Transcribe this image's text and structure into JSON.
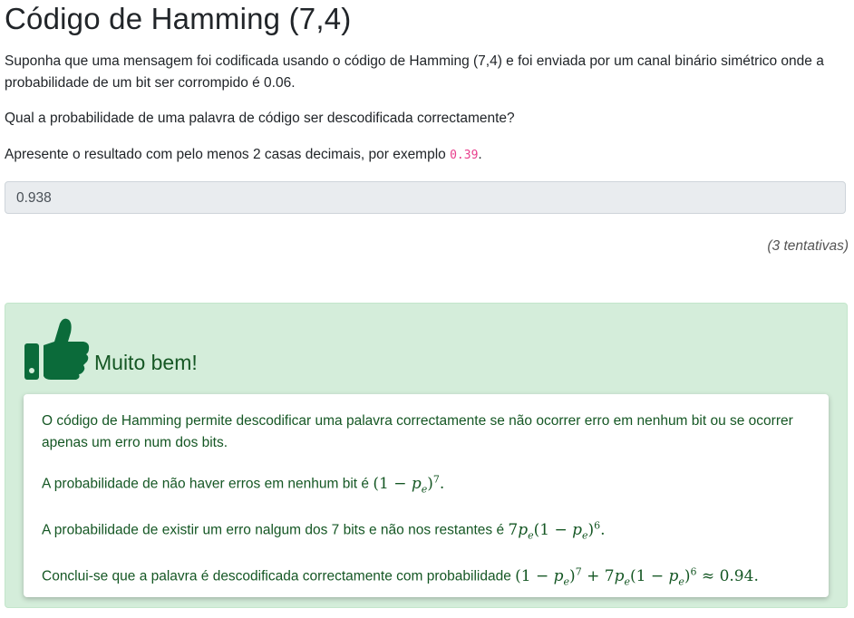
{
  "page": {
    "title": "Código de Hamming (7,4)",
    "paragraph1": "Suponha que uma mensagem foi codificada usando o código de Hamming (7,4) e foi enviada por um canal binário simétrico onde a probabilidade de um bit ser corrompido é 0.06.",
    "question": "Qual a probabilidade de uma palavra de código ser descodificada correctamente?",
    "instruction_prefix": "Apresente o resultado com pelo menos 2 casas decimais, por exemplo ",
    "instruction_example": "0.39",
    "instruction_suffix": "."
  },
  "answer": {
    "value": "0.938"
  },
  "attempts": "(3 tentativas)",
  "feedback": {
    "icon": "thumbs-up-icon",
    "heading": "Muito bem!",
    "explanation1": "O código de Hamming permite descodificar uma palavra correctamente se não ocorrer erro em nenhum bit ou se ocorrer apenas um erro num dos bits.",
    "explanation2_text": "A probabilidade de não haver erros em nenhum bit é ",
    "explanation3_text": "A probabilidade de existir um erro nalgum dos 7 bits e não nos restantes é ",
    "explanation4_text": "Conclui-se que a palavra é descodificada correctamente com probabilidade ",
    "approx_value": "0.94",
    "colors": {
      "background": "#d4edda",
      "text": "#155724"
    }
  }
}
